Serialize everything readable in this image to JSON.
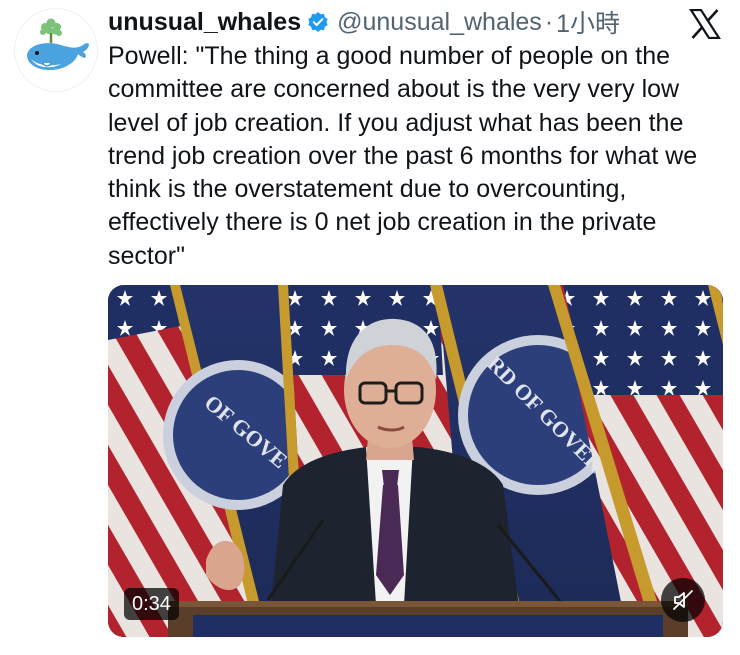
{
  "account": {
    "display_name": "unusual_whales",
    "handle": "@unusual_whales",
    "separator": "·",
    "time": "1小時",
    "verified": true
  },
  "tweet": {
    "text": "Powell: \"The thing a good number of people on the committee are concerned about is the very very low level of job creation. If you adjust what has been the trend job creation over the past 6 months for what we think is the overstatement due to overcounting, effectively there is 0 net job creation in the private sector\""
  },
  "media": {
    "type": "video",
    "duration": "0:34",
    "muted": true
  },
  "icons": {
    "verified": "verified-badge-icon",
    "brand": "x-logo-icon",
    "mute": "muted-speaker-icon"
  },
  "colors": {
    "verified_blue": "#1d9bf0",
    "secondary_text": "#536471",
    "primary_text": "#0f1419"
  }
}
